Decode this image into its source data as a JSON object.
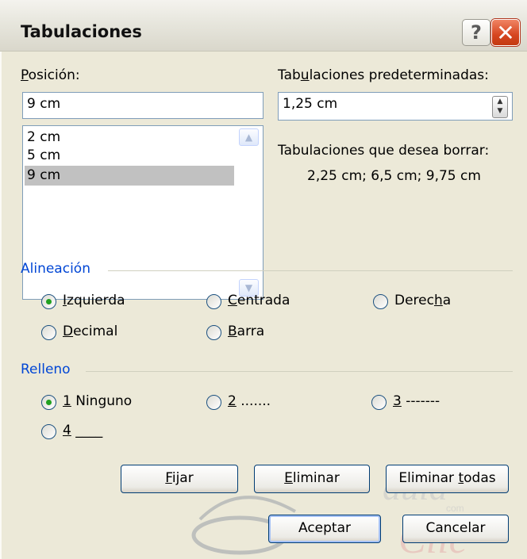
{
  "window": {
    "title": "Tabulaciones",
    "help_glyph": "?",
    "close_glyph": "✕"
  },
  "posicion": {
    "label_u": "P",
    "label_rest": "osición:",
    "value": "9 cm",
    "items": [
      "2 cm",
      "5 cm",
      "9 cm"
    ],
    "selected_index": 2
  },
  "predeterminadas": {
    "label_a": "Tab",
    "label_u": "u",
    "label_b": "laciones predeterminadas:",
    "value": "1,25 cm"
  },
  "borrar": {
    "label": "Tabulaciones que desea borrar:",
    "values": "2,25 cm; 6,5 cm; 9,75 cm"
  },
  "alineacion": {
    "title": "Alineación",
    "options": [
      {
        "u": "I",
        "rest": "zquierda",
        "checked": true
      },
      {
        "u": "C",
        "rest": "entrada",
        "checked": false
      },
      {
        "pre": "Derec",
        "u": "h",
        "rest": "a",
        "checked": false
      },
      {
        "u": "D",
        "rest": "ecimal",
        "checked": false
      },
      {
        "u": "B",
        "rest": "arra",
        "checked": false
      }
    ]
  },
  "relleno": {
    "title": "Relleno",
    "options": [
      {
        "u": "1",
        "rest": " Ninguno",
        "checked": true
      },
      {
        "u": "2",
        "rest": " .......",
        "checked": false
      },
      {
        "u": "3",
        "rest": " -------",
        "checked": false
      },
      {
        "u": "4",
        "rest": " ____",
        "checked": false
      }
    ]
  },
  "buttons": {
    "fijar": {
      "u": "F",
      "rest": "ijar"
    },
    "eliminar": {
      "u": "E",
      "rest": "liminar"
    },
    "eliminar_todas": {
      "pre": "Eliminar ",
      "u": "t",
      "rest": "odas"
    },
    "aceptar": "Aceptar",
    "cancelar": "Cancelar"
  },
  "colors": {
    "group_title": "#0046d5",
    "radio_dot": "#21a121",
    "close_button": "#d6451f",
    "watermark": "#c7312a"
  },
  "watermark": {
    "text_top": "aula",
    "text_small": "com",
    "text_bottom": "Clic"
  }
}
